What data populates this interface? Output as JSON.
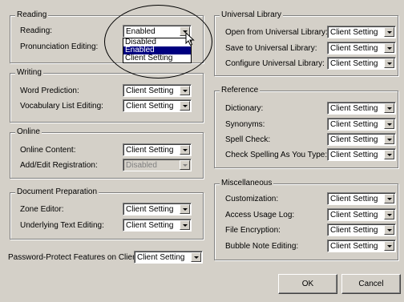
{
  "reading": {
    "title": "Reading",
    "reading_label": "Reading:",
    "reading_value": "Enabled",
    "reading_options": [
      "Disabled",
      "Enabled",
      "Client Setting"
    ],
    "pronunciation_label": "Pronunciation Editing:"
  },
  "writing": {
    "title": "Writing",
    "word_prediction_label": "Word Prediction:",
    "word_prediction_value": "Client Setting",
    "vocab_label": "Vocabulary List Editing:",
    "vocab_value": "Client Setting"
  },
  "online": {
    "title": "Online",
    "content_label": "Online Content:",
    "content_value": "Client Setting",
    "registration_label": "Add/Edit Registration:",
    "registration_value": "Disabled"
  },
  "document_prep": {
    "title": "Document Preparation",
    "zone_label": "Zone Editor:",
    "zone_value": "Client Setting",
    "underlying_label": "Underlying Text Editing:",
    "underlying_value": "Client Setting"
  },
  "password": {
    "label": "Password-Protect Features on Client:",
    "value": "Client Setting"
  },
  "universal_library": {
    "title": "Universal Library",
    "open_label": "Open from Universal Library:",
    "open_value": "Client Setting",
    "save_label": "Save to Universal Library:",
    "save_value": "Client Setting",
    "configure_label": "Configure Universal Library:",
    "configure_value": "Client Setting"
  },
  "reference": {
    "title": "Reference",
    "dictionary_label": "Dictionary:",
    "dictionary_value": "Client Setting",
    "synonyms_label": "Synonyms:",
    "synonyms_value": "Client Setting",
    "spell_label": "Spell Check:",
    "spell_value": "Client Setting",
    "check_spelling_label": "Check Spelling As You Type:",
    "check_spelling_value": "Client Setting"
  },
  "misc": {
    "title": "Miscellaneous",
    "customization_label": "Customization:",
    "customization_value": "Client Setting",
    "access_label": "Access Usage Log:",
    "access_value": "Client Setting",
    "encryption_label": "File Encryption:",
    "encryption_value": "Client Setting",
    "bubble_label": "Bubble Note Editing:",
    "bubble_value": "Client Setting"
  },
  "buttons": {
    "ok": "OK",
    "cancel": "Cancel"
  },
  "colors": {
    "face": "#d4d0c8",
    "highlight": "#000080"
  }
}
